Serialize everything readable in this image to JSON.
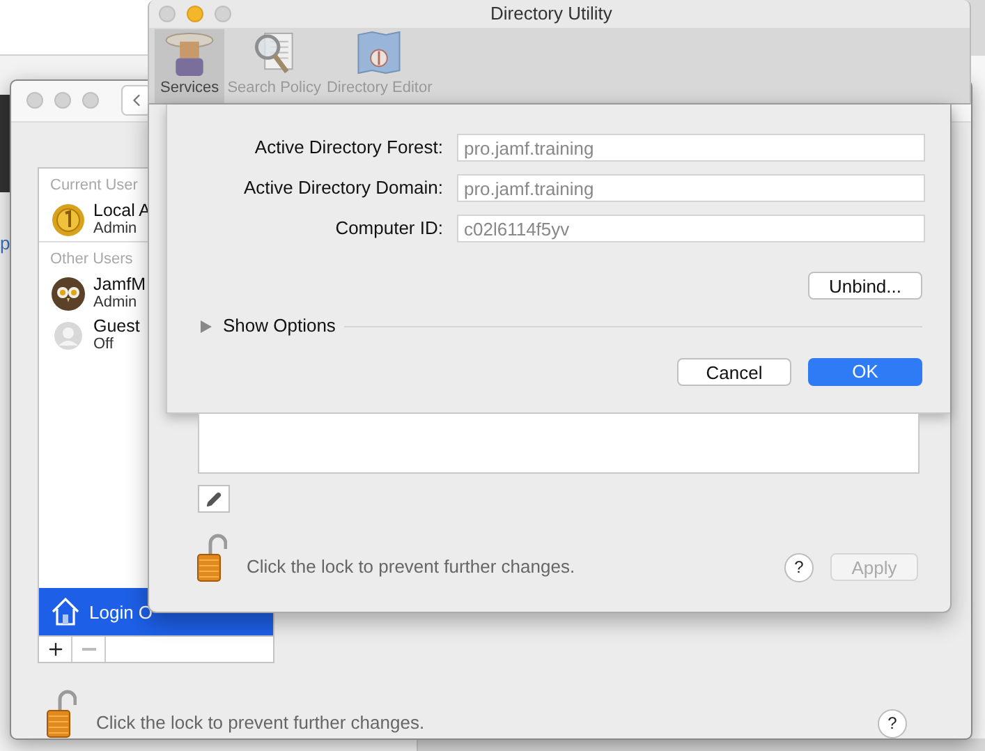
{
  "background_window": {
    "fragments": [
      {
        "text": "p",
        "kind": "link"
      }
    ]
  },
  "users_window": {
    "sections": [
      {
        "header": "Current User",
        "users": [
          {
            "name": "Local A",
            "role": "Admin",
            "kind": "coin"
          }
        ]
      },
      {
        "header": "Other Users",
        "users": [
          {
            "name": "JamfM",
            "role": "Admin",
            "kind": "owl"
          },
          {
            "name": "Guest",
            "role": "Off",
            "kind": "guest"
          }
        ]
      }
    ],
    "login_options": {
      "label": "Login O",
      "selected": true
    },
    "lock_text": "Click the lock to prevent further changes.",
    "help": "?"
  },
  "directory_utility": {
    "title": "Directory Utility",
    "tabs": [
      {
        "label": "Services",
        "selected": true,
        "kind": "services"
      },
      {
        "label": "Search Policy",
        "selected": false,
        "kind": "search"
      },
      {
        "label": "Directory Editor",
        "selected": false,
        "kind": "editor"
      }
    ],
    "fields": [
      {
        "label": "Active Directory Forest:",
        "value": "pro.jamf.training"
      },
      {
        "label": "Active Directory Domain:",
        "value": "pro.jamf.training"
      },
      {
        "label": "Computer ID:",
        "value": "c02l6114f5yv"
      }
    ],
    "unbind": "Unbind...",
    "show_options": {
      "label": "Show Options",
      "expanded": false
    },
    "cancel": "Cancel",
    "ok": "OK",
    "lock_text": "Click the lock to prevent further changes.",
    "help": "?",
    "apply": {
      "label": "Apply",
      "disabled": true
    }
  }
}
